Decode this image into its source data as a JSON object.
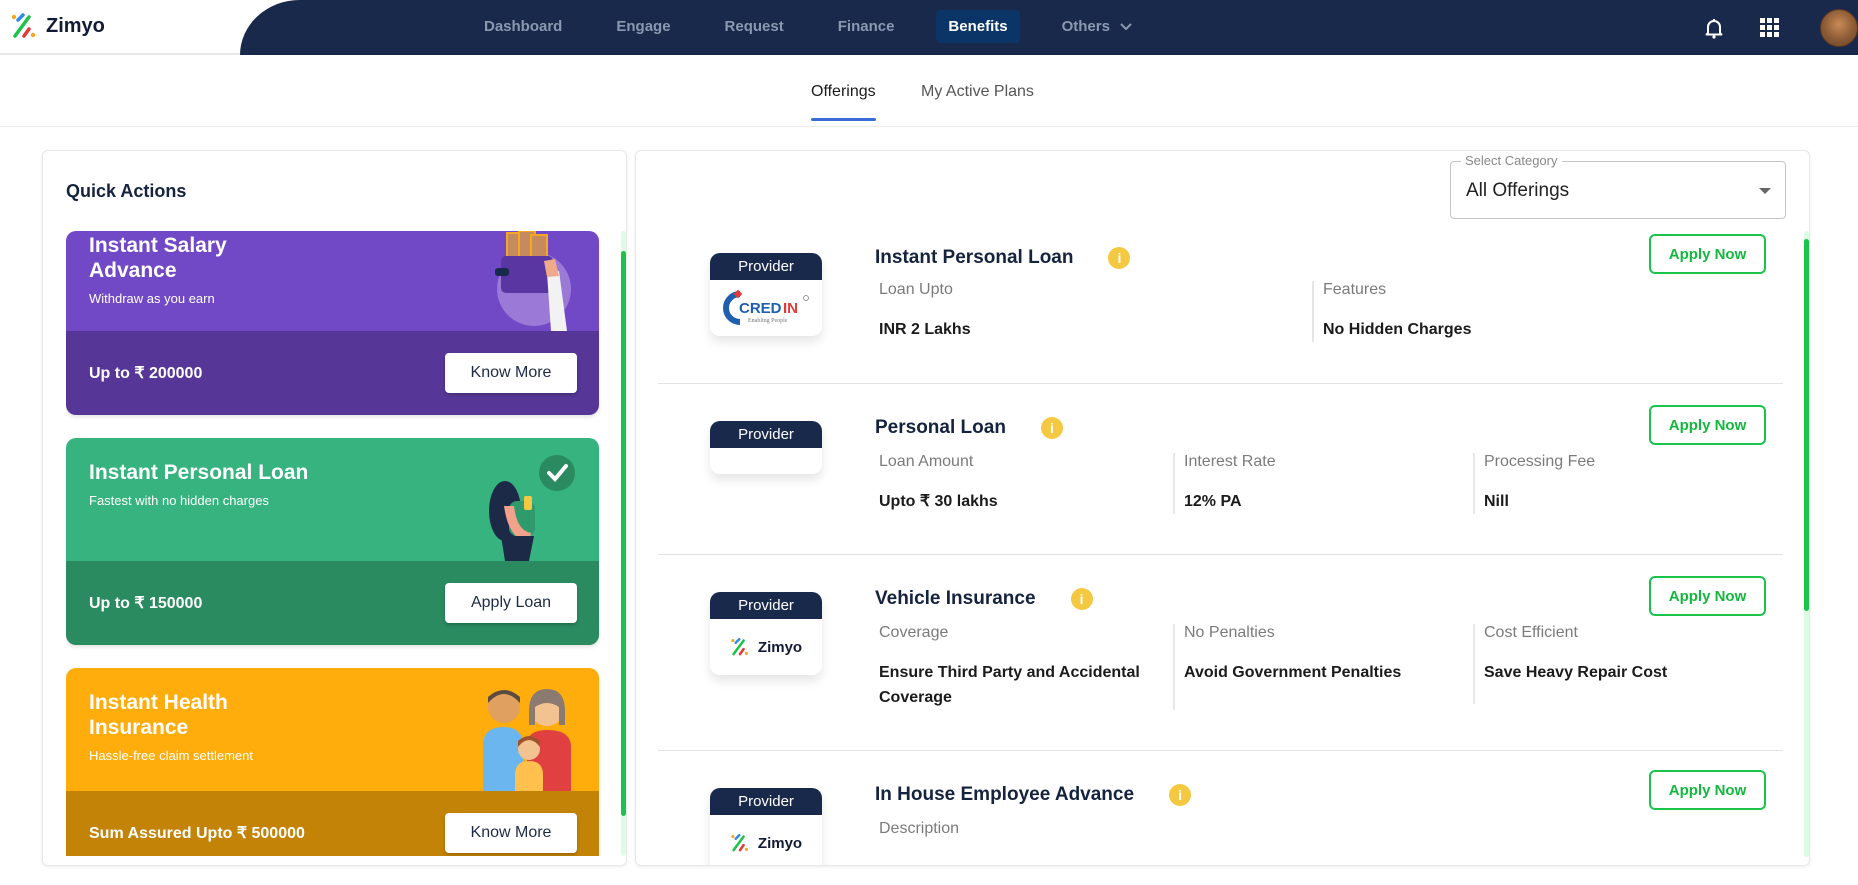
{
  "app": {
    "name": "Zimyo",
    "colors": {
      "nav_bg": "#18294b",
      "active_nav": "#0b3566",
      "accent_green": "#1ac44a",
      "tab_underline": "#3a6bd6",
      "info_yellow": "#f5c842"
    }
  },
  "nav": {
    "items": [
      {
        "label": "Dashboard",
        "active": false
      },
      {
        "label": "Engage",
        "active": false
      },
      {
        "label": "Request",
        "active": false
      },
      {
        "label": "Finance",
        "active": false
      },
      {
        "label": "Benefits",
        "active": true
      },
      {
        "label": "Others",
        "active": false,
        "has_dropdown": true
      }
    ],
    "icons": [
      "bell-icon",
      "apps-grid-icon",
      "user-avatar"
    ]
  },
  "tabs": [
    {
      "label": "Offerings",
      "active": true
    },
    {
      "label": "My Active Plans",
      "active": false
    }
  ],
  "quick_actions": {
    "title": "Quick Actions",
    "cards": [
      {
        "title": "Instant Salary Advance",
        "subtitle": "Withdraw as you earn",
        "amount": "Up to ₹ 200000",
        "button": "Know More",
        "color_top": "#7149c6",
        "color_bottom": "#563797"
      },
      {
        "title": "Instant Personal Loan",
        "subtitle": "Fastest with no hidden charges",
        "amount": "Up to ₹ 150000",
        "button": "Apply Loan",
        "color_top": "#36b37e",
        "color_bottom": "#2a8a60"
      },
      {
        "title": "Instant Health Insurance",
        "subtitle": "Hassle-free claim settlement",
        "amount": "Sum Assured Upto ₹ 500000",
        "button": "Know More",
        "color_top": "#ffad0d",
        "color_bottom": "#c28306"
      }
    ]
  },
  "category_select": {
    "label": "Select Category",
    "value": "All Offerings"
  },
  "offerings": [
    {
      "title": "Instant Personal Loan",
      "provider_label": "Provider",
      "provider_logo": "CREDIN",
      "provider_tagline": "Enabling People",
      "apply_label": "Apply Now",
      "fields": [
        {
          "label": "Loan Upto",
          "value": "INR 2 Lakhs"
        },
        {
          "label": "Features",
          "value": "No Hidden Charges"
        }
      ]
    },
    {
      "title": "Personal Loan",
      "provider_label": "Provider",
      "provider_logo": "",
      "apply_label": "Apply Now",
      "fields": [
        {
          "label": "Loan Amount",
          "value": "Upto ₹ 30 lakhs"
        },
        {
          "label": "Interest Rate",
          "value": "12% PA"
        },
        {
          "label": "Processing Fee",
          "value": "Nill"
        }
      ]
    },
    {
      "title": "Vehicle Insurance",
      "provider_label": "Provider",
      "provider_logo": "Zimyo",
      "apply_label": "Apply Now",
      "fields": [
        {
          "label": "Coverage",
          "value": "Ensure Third Party and Accidental Coverage"
        },
        {
          "label": "No Penalties",
          "value": "Avoid Government Penalties"
        },
        {
          "label": "Cost Efficient",
          "value": "Save Heavy Repair Cost"
        }
      ]
    },
    {
      "title": "In House Employee Advance",
      "provider_label": "Provider",
      "provider_logo": "Zimyo",
      "apply_label": "Apply Now",
      "fields": [
        {
          "label": "Description",
          "value": ""
        }
      ]
    }
  ]
}
